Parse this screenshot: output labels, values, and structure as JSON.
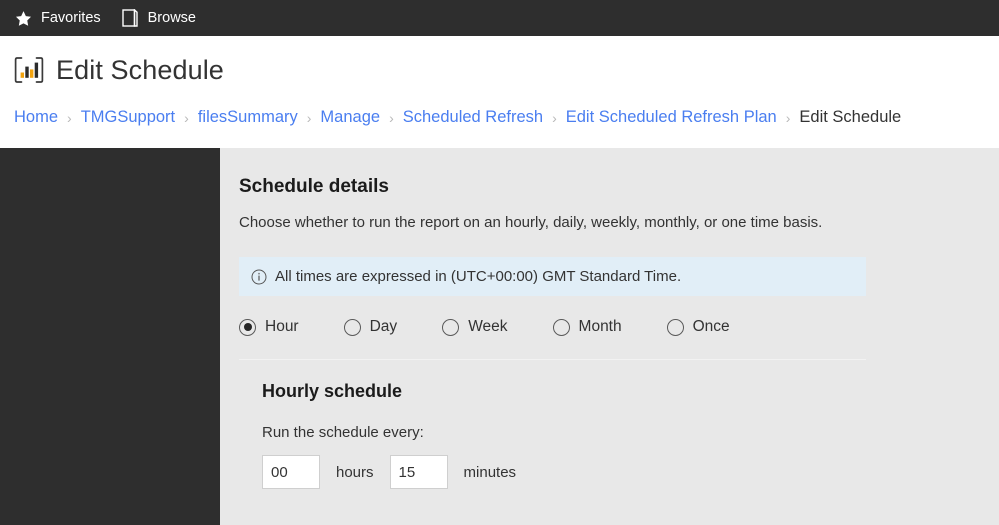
{
  "topbar": {
    "items": [
      {
        "label": "Favorites",
        "icon": "star-icon"
      },
      {
        "label": "Browse",
        "icon": "browse-page-icon"
      }
    ]
  },
  "header": {
    "app_icon": "power-bi-report-icon",
    "title": "Edit Schedule"
  },
  "breadcrumb": {
    "separator": "›",
    "items": [
      {
        "label": "Home",
        "current": false
      },
      {
        "label": "TMGSupport",
        "current": false
      },
      {
        "label": "filesSummary",
        "current": false
      },
      {
        "label": "Manage",
        "current": false
      },
      {
        "label": "Scheduled Refresh",
        "current": false
      },
      {
        "label": "Edit Scheduled Refresh Plan",
        "current": false
      },
      {
        "label": "Edit Schedule",
        "current": true
      }
    ]
  },
  "main": {
    "section_title": "Schedule details",
    "section_desc": "Choose whether to run the report on an hourly, daily, weekly, monthly, or one time basis.",
    "info": {
      "icon": "info-circle-icon",
      "text": "All times are expressed in (UTC+00:00) GMT Standard Time."
    },
    "frequency": {
      "selected": "Hour",
      "options": [
        {
          "label": "Hour"
        },
        {
          "label": "Day"
        },
        {
          "label": "Week"
        },
        {
          "label": "Month"
        },
        {
          "label": "Once"
        }
      ]
    },
    "hourly": {
      "title": "Hourly schedule",
      "label": "Run the schedule every:",
      "hours_value": "00",
      "hours_unit": "hours",
      "minutes_value": "15",
      "minutes_unit": "minutes"
    }
  },
  "colors": {
    "topbar_bg": "#2e2e2e",
    "sidebar_bg": "#2e2e2e",
    "content_bg": "#e8e8e8",
    "link": "#4a7ef0",
    "info_bg": "#e1eef7",
    "accent_chart": "#f2a30f"
  }
}
